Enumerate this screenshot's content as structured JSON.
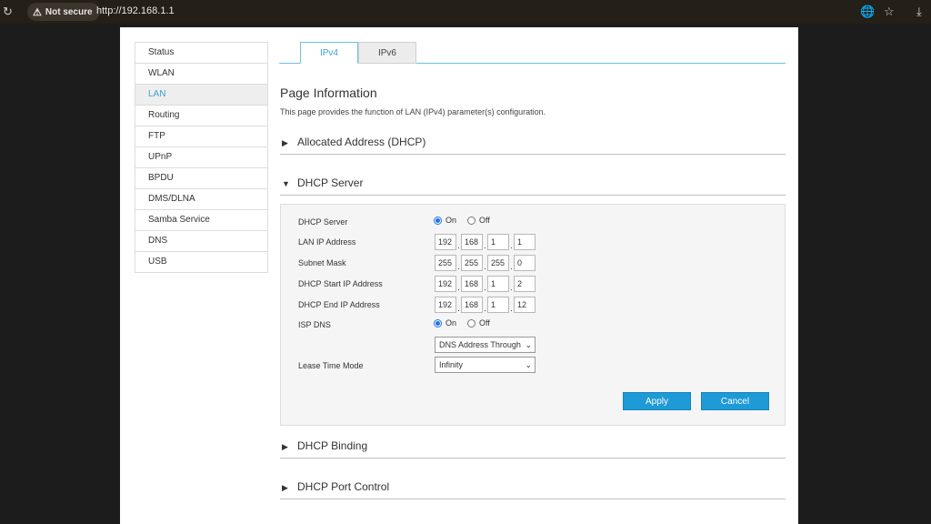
{
  "browser": {
    "security_label": "Not secure",
    "url": "http://192.168.1.1"
  },
  "sidebar": {
    "items": [
      {
        "label": "Status"
      },
      {
        "label": "WLAN"
      },
      {
        "label": "LAN"
      },
      {
        "label": "Routing"
      },
      {
        "label": "FTP"
      },
      {
        "label": "UPnP"
      },
      {
        "label": "BPDU"
      },
      {
        "label": "DMS/DLNA"
      },
      {
        "label": "Samba Service"
      },
      {
        "label": "DNS"
      },
      {
        "label": "USB"
      }
    ],
    "active": "LAN"
  },
  "tabs": [
    {
      "label": "IPv4"
    },
    {
      "label": "IPv6"
    }
  ],
  "page": {
    "title": "Page Information",
    "description": "This page provides the function of LAN (IPv4) parameter(s) configuration."
  },
  "sections": {
    "allocated": "Allocated Address (DHCP)",
    "dhcp_server": "DHCP Server",
    "binding": "DHCP Binding",
    "port_control": "DHCP Port Control"
  },
  "form": {
    "dhcp_server": {
      "label": "DHCP Server",
      "on": "On",
      "off": "Off",
      "selected": "On"
    },
    "lan_ip": {
      "label": "LAN IP Address",
      "octets": [
        "192",
        "168",
        "1",
        "1"
      ]
    },
    "subnet": {
      "label": "Subnet Mask",
      "octets": [
        "255",
        "255",
        "255",
        "0"
      ]
    },
    "start_ip": {
      "label": "DHCP Start IP Address",
      "octets": [
        "192",
        "168",
        "1",
        "2"
      ]
    },
    "end_ip": {
      "label": "DHCP End IP Address",
      "octets": [
        "192",
        "168",
        "1",
        "12"
      ]
    },
    "isp_dns": {
      "label": "ISP DNS",
      "on": "On",
      "off": "Off",
      "selected": "On",
      "select_value": "DNS Address Through"
    },
    "lease": {
      "label": "Lease Time Mode",
      "value": "Infinity"
    },
    "apply": "Apply",
    "cancel": "Cancel"
  },
  "colors": {
    "accent": "#1e9ad6",
    "tab_accent": "#3aa0d4"
  }
}
